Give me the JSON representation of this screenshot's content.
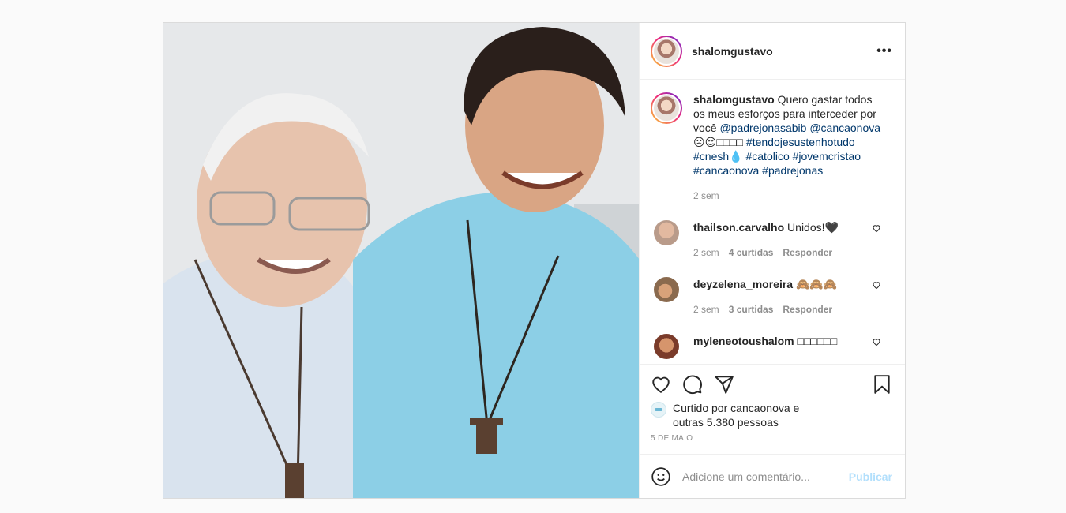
{
  "post": {
    "author": "shalomgustavo",
    "more_icon": "more-horizontal-icon",
    "caption": {
      "username": "shalomgustavo",
      "text": " Quero gastar todos os meus esforços para interceder por você ",
      "mentions": [
        "@padrejonasabib",
        "@cancaonova"
      ],
      "emojis": "☹😌□□□□",
      "hashtags_line1": "#tendojesustenhotudo",
      "hashtags_line2_a": "#cnesh",
      "drop": "💧",
      "hashtags_line2_b": "#catolico #jovemcristao",
      "hashtags_line3": "#cancaonova #padrejonas",
      "time": "2 sem"
    },
    "comments": [
      {
        "user": "thailson.carvalho",
        "text": " Unidos!🖤",
        "time": "2 sem",
        "likes": "4 curtidas",
        "reply": "Responder",
        "avatar_color": "#b99b8a"
      },
      {
        "user": "deyzelena_moreira",
        "text": " 🙈🙈🙈",
        "time": "2 sem",
        "likes": "3 curtidas",
        "reply": "Responder",
        "avatar_color": "#8a6a4e"
      },
      {
        "user": "myleneotoushalom",
        "text": " □□□□□□",
        "time": "",
        "likes": "",
        "reply": "",
        "avatar_color": "#7a3b2a"
      }
    ],
    "actions": {
      "like_icon": "heart-icon",
      "comment_icon": "comment-icon",
      "share_icon": "share-icon",
      "save_icon": "bookmark-icon"
    },
    "likes": {
      "prefix": "Curtido por ",
      "user": "cancaonova",
      "suffix": " e",
      "others": "outras 5.380 pessoas"
    },
    "date": "5 DE MAIO",
    "add_comment": {
      "placeholder": "Adicione um comentário...",
      "publish": "Publicar",
      "emoji_icon": "smile-icon"
    }
  }
}
